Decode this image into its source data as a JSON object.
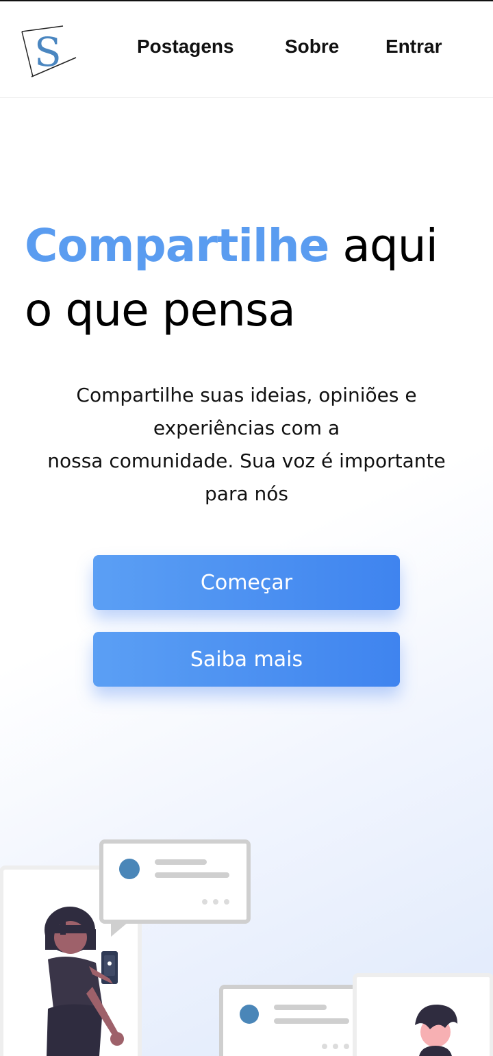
{
  "header": {
    "logo_letter": "S",
    "nav": {
      "posts": "Postagens",
      "about": "Sobre",
      "login": "Entrar"
    }
  },
  "hero": {
    "title_accent": "Compartilhe",
    "title_rest_line1": " aqui",
    "title_line2": "o que pensa",
    "subtitle_lines": [
      "Compartilhe suas ideias, opiniões e",
      "experiências com a",
      "nossa comunidade. Sua voz é importante",
      "para nós"
    ],
    "primary_button": "Começar",
    "secondary_button": "Saiba mais"
  },
  "colors": {
    "accent": "#5a9cf0",
    "button_start": "#5b9ff4",
    "button_end": "#3f84ef"
  },
  "icons": [
    "logo-icon",
    "chat-bubble-icon",
    "person-illustration"
  ]
}
